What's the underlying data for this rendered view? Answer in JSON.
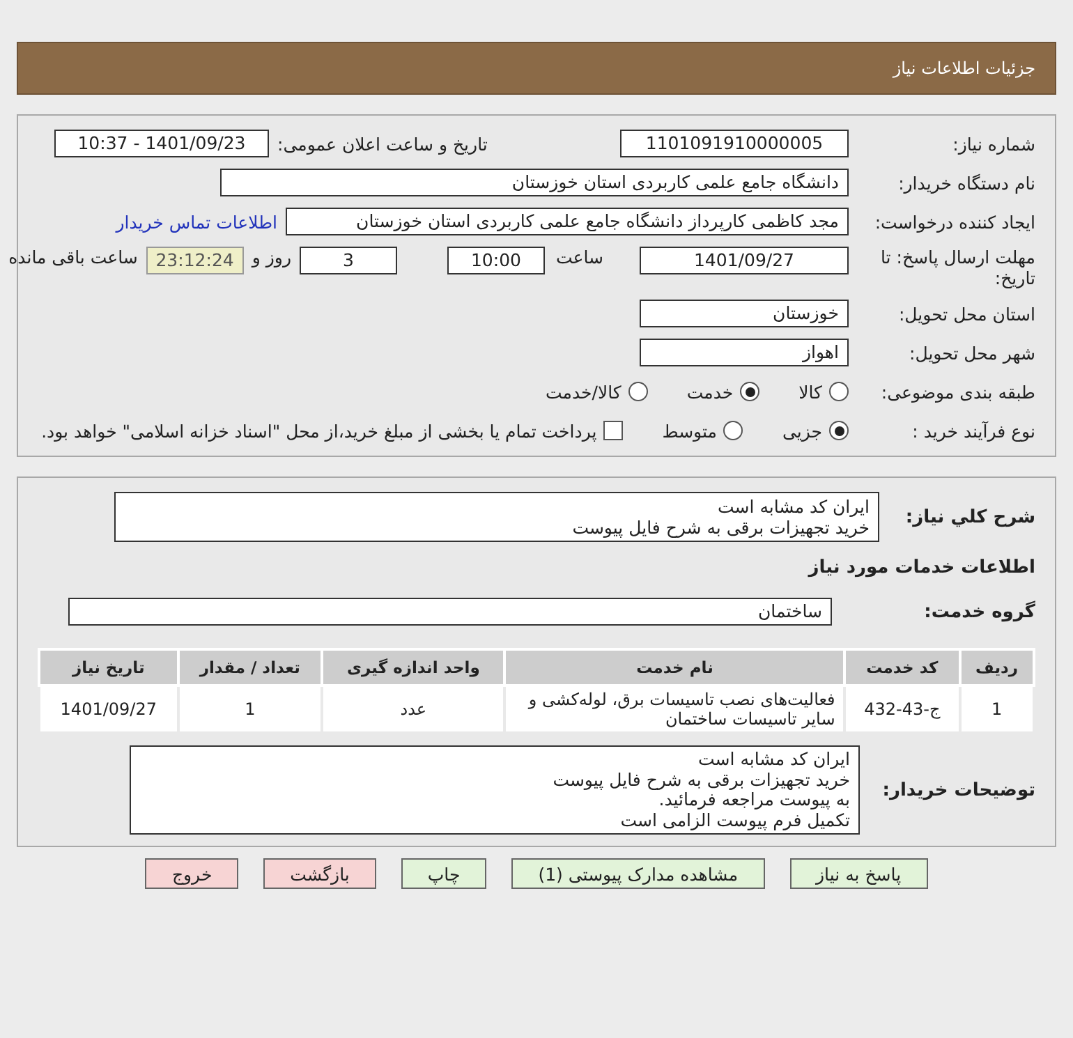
{
  "header": {
    "title": "جزئیات اطلاعات نیاز"
  },
  "need_number": {
    "label": "شماره نیاز:",
    "value": "1101091910000005"
  },
  "announce": {
    "label": "تاریخ و ساعت اعلان عمومی:",
    "value": "1401/09/23 - 10:37"
  },
  "buyer": {
    "label": "نام دستگاه خریدار:",
    "value": "دانشگاه جامع علمی کاربردی استان خوزستان"
  },
  "requester": {
    "label": "ایجاد کننده درخواست:",
    "value": "مجد  کاظمی کارپرداز دانشگاه جامع علمی کاربردی استان خوزستان",
    "link": "اطلاعات تماس خریدار"
  },
  "deadline": {
    "label": "مهلت ارسال پاسخ: تا تاریخ:",
    "date": "1401/09/27",
    "time_label": "ساعت",
    "time": "10:00",
    "days": "3",
    "days_label": "روز و",
    "remaining": "23:12:24",
    "remaining_label": "ساعت باقی مانده"
  },
  "province": {
    "label": "استان محل تحویل:",
    "value": "خوزستان"
  },
  "city": {
    "label": "شهر محل تحویل:",
    "value": "اهواز"
  },
  "category": {
    "label": "طبقه بندی موضوعی:",
    "options": [
      {
        "label": "کالا",
        "selected": false
      },
      {
        "label": "خدمت",
        "selected": true
      },
      {
        "label": "کالا/خدمت",
        "selected": false
      }
    ]
  },
  "process": {
    "label": "نوع فرآیند خرید :",
    "options": [
      {
        "label": "جزیی",
        "selected": true
      },
      {
        "label": "متوسط",
        "selected": false
      }
    ],
    "payment": {
      "checked": false,
      "text": "پرداخت تمام یا بخشی از مبلغ خرید،از محل \"اسناد خزانه اسلامی\" خواهد بود."
    }
  },
  "summary": {
    "label": "شرح کلي نياز:",
    "lines": [
      "ایران کد مشابه است",
      "خرید تجهیزات برقی به شرح فایل پیوست"
    ]
  },
  "services_title": "اطلاعات خدمات مورد نیاز",
  "service_group": {
    "label": "گروه خدمت:",
    "value": "ساختمان"
  },
  "table": {
    "columns": [
      "ردیف",
      "کد خدمت",
      "نام خدمت",
      "واحد اندازه گیری",
      "تعداد / مقدار",
      "تاریخ نیاز"
    ],
    "rows": [
      [
        "1",
        "ج-43-432",
        "فعالیت‌های نصب تاسیسات برق، لوله‌کشی و سایر تاسیسات ساختمان",
        "عدد",
        "1",
        "1401/09/27"
      ]
    ]
  },
  "buyer_notes": {
    "label": "توضیحات خریدار:",
    "lines": [
      "ایران کد مشابه است",
      "خرید تجهیزات برقی به شرح فایل پیوست",
      "به پیوست مراجعه فرمائید.",
      "تکمیل فرم پیوست الزامی است"
    ]
  },
  "buttons": [
    {
      "label": "پاسخ به نیاز",
      "kind": "normal"
    },
    {
      "label": "مشاهده مدارک پیوستی (1)",
      "kind": "normal"
    },
    {
      "label": "چاپ",
      "kind": "normal"
    },
    {
      "label": "بازگشت",
      "kind": "danger"
    },
    {
      "label": "خروج",
      "kind": "danger"
    }
  ]
}
